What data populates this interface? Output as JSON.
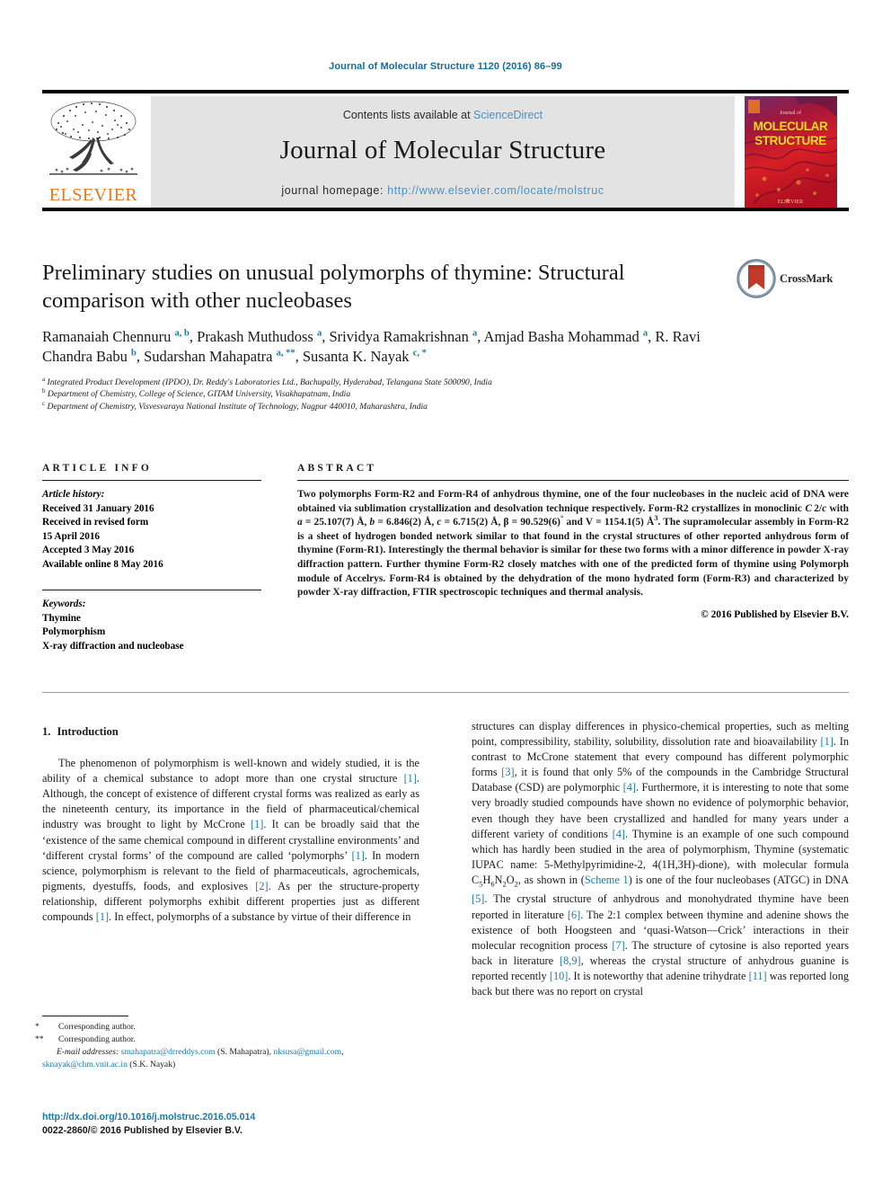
{
  "running_head": "Journal of Molecular Structure 1120 (2016) 86–99",
  "masthead": {
    "publisher": "ELSEVIER",
    "contents_prefix": "Contents lists available at ",
    "contents_link": "ScienceDirect",
    "journal_title": "Journal of Molecular Structure",
    "homepage_prefix": "journal homepage: ",
    "homepage_url": "http://www.elsevier.com/locate/molstruc",
    "cover_title_line1": "MOLECULAR",
    "cover_title_line2": "STRUCTURE",
    "cover_publisher": "ELSEVIER",
    "cover_small_text": "Journal of"
  },
  "crossmark": {
    "label": "CrossMark"
  },
  "article": {
    "title": "Preliminary studies on unusual polymorphs of thymine: Structural comparison with other nucleobases",
    "authors_html": "Ramanaiah Chennuru <sup>a, b</sup>, Prakash Muthudoss <sup>a</sup>, Srividya Ramakrishnan <sup>a</sup>, Amjad Basha Mohammad <sup>a</sup>, R. Ravi Chandra Babu <sup>b</sup>, Sudarshan Mahapatra <sup>a, **</sup>, Susanta K. Nayak <sup>c, *</sup>",
    "affiliations": [
      {
        "mark": "a",
        "text": "Integrated Product Development (IPDO), Dr. Reddy's Laboratories Ltd., Bachupally, Hyderabad, Telangana State 500090, India"
      },
      {
        "mark": "b",
        "text": "Department of Chemistry, College of Science, GITAM University, Visakhapatnam, India"
      },
      {
        "mark": "c",
        "text": "Department of Chemistry, Visvesvaraya National Institute of Technology, Nagpur 440010, Maharashtra, India"
      }
    ]
  },
  "article_info": {
    "heading": "ARTICLE INFO",
    "history_label": "Article history:",
    "history": [
      "Received 31 January 2016",
      "Received in revised form",
      "15 April 2016",
      "Accepted 3 May 2016",
      "Available online 8 May 2016"
    ],
    "keywords_label": "Keywords:",
    "keywords": [
      "Thymine",
      "Polymorphism",
      "X-ray diffraction and nucleobase"
    ]
  },
  "abstract": {
    "heading": "ABSTRACT",
    "body_html": "Two polymorphs Form-R2 and Form-R4 of anhydrous thymine, one of the four nucleobases in the nucleic acid of DNA were obtained via sublimation crystallization and desolvation technique respectively. Form-R2 crystallizes in monoclinic <i>C</i>&thinsp;2/<i>c</i> with <i>a</i>&nbsp;=&nbsp;25.107(7)&nbsp;Å, <i>b</i>&nbsp;=&nbsp;6.846(2)&nbsp;Å, <i>c</i>&nbsp;=&nbsp;6.715(2)&nbsp;Å, β&nbsp;=&nbsp;90.529(6)<sup class=\"plain\">°</sup> and V&nbsp;=&nbsp;1154.1(5)&nbsp;Å<sup class=\"plain\">3</sup>. The supramolecular assembly in Form-R2 is a sheet of hydrogen bonded network similar to that found in the crystal structures of other reported anhydrous form of thymine (Form-R1). Interestingly the thermal behavior is similar for these two forms with a minor difference in powder X-ray diffraction pattern. Further thymine Form-R2 closely matches with one of the predicted form of thymine using Polymorph module of Accelrys. Form-R4 is obtained by the dehydration of the mono hydrated form (Form-R3) and characterized by powder X-ray diffraction, FTIR spectroscopic techniques and thermal analysis.",
    "copyright": "© 2016 Published by Elsevier B.V."
  },
  "body": {
    "section_number": "1.",
    "section_title": "Introduction",
    "left_paragraph_html": "The phenomenon of polymorphism is well-known and widely studied, it is the ability of a chemical substance to adopt more than one crystal structure <span class=\"ref\">[1]</span>. Although, the concept of existence of different crystal forms was realized as early as the nineteenth century, its importance in the field of pharmaceutical/chemical industry was brought to light by McCrone <span class=\"ref\">[1]</span>. It can be broadly said that the ‘existence of the same chemical compound in different crystalline environments’ and ‘different crystal forms’ of the compound are called ‘polymorphs’ <span class=\"ref\">[1]</span>. In modern science, polymorphism is relevant to the field of pharmaceuticals, agrochemicals, pigments, dyestuffs, foods, and explosives <span class=\"ref\">[2]</span>. As per the structure-property relationship, different polymorphs exhibit different properties just as different compounds <span class=\"ref\">[1]</span>. In effect, polymorphs of a substance by virtue of their difference in",
    "right_paragraph_html": "structures can display differences in physico-chemical properties, such as melting point, compressibility, stability, solubility, dissolution rate and bioavailability <span class=\"ref\">[1]</span>. In contrast to McCrone statement that every compound has different polymorphic forms <span class=\"ref\">[3]</span>, it is found that only 5% of the compounds in the Cambridge Structural Database (CSD) are polymorphic <span class=\"ref\">[4]</span>. Furthermore, it is interesting to note that some very broadly studied compounds have shown no evidence of polymorphic behavior, even though they have been crystallized and handled for many years under a different variety of conditions <span class=\"ref\">[4]</span>. Thymine is an example of one such compound which has hardly been studied in the area of polymorphism, Thymine (systematic IUPAC name: 5-Methylpyrimidine-2, 4(1H,3H)-dione), with molecular formula C<sub>5</sub>H<sub>6</sub>N<sub>2</sub>O<sub>2</sub>, as shown in (<span class=\"lnk\">Scheme 1</span>) is one of the four nucleobases (ATGC) in DNA <span class=\"ref\">[5]</span>. The crystal structure of anhydrous and monohydrated thymine have been reported in literature <span class=\"ref\">[6]</span>. The 2:1 complex between thymine and adenine shows the existence of both Hoogsteen and ‘quasi-Watson—Crick’ interactions in their molecular recognition process <span class=\"ref\">[7]</span>. The structure of cytosine is also reported years back in literature <span class=\"ref\">[8,9]</span>, whereas the crystal structure of anhydrous guanine is reported recently <span class=\"ref\">[10]</span>. It is noteworthy that adenine trihydrate <span class=\"ref\">[11]</span> was reported long back but there was no report on crystal"
  },
  "footnotes": {
    "line1_mark": "*",
    "line1_text": "Corresponding author.",
    "line2_mark": "**",
    "line2_text": "Corresponding author.",
    "emails_label": "E-mail addresses:",
    "email1": "smahapatra@drreddys.com",
    "email1_owner": "(S. Mahapatra)",
    "email2": "nksusa@gmail.com",
    "email2_sep": ",",
    "email3": "sknayak@chm.vnit.ac.in",
    "email3_owner": "(S.K. Nayak)"
  },
  "doi_block": {
    "doi_url": "http://dx.doi.org/10.1016/j.molstruc.2016.05.014",
    "issn_line": "0022-2860/© 2016 Published by Elsevier B.V."
  },
  "colors": {
    "link_blue": "#1a7ba8",
    "light_blue": "#4b93c4",
    "elsevier_orange": "#e87722",
    "grey_bar": "#e3e3e3"
  }
}
